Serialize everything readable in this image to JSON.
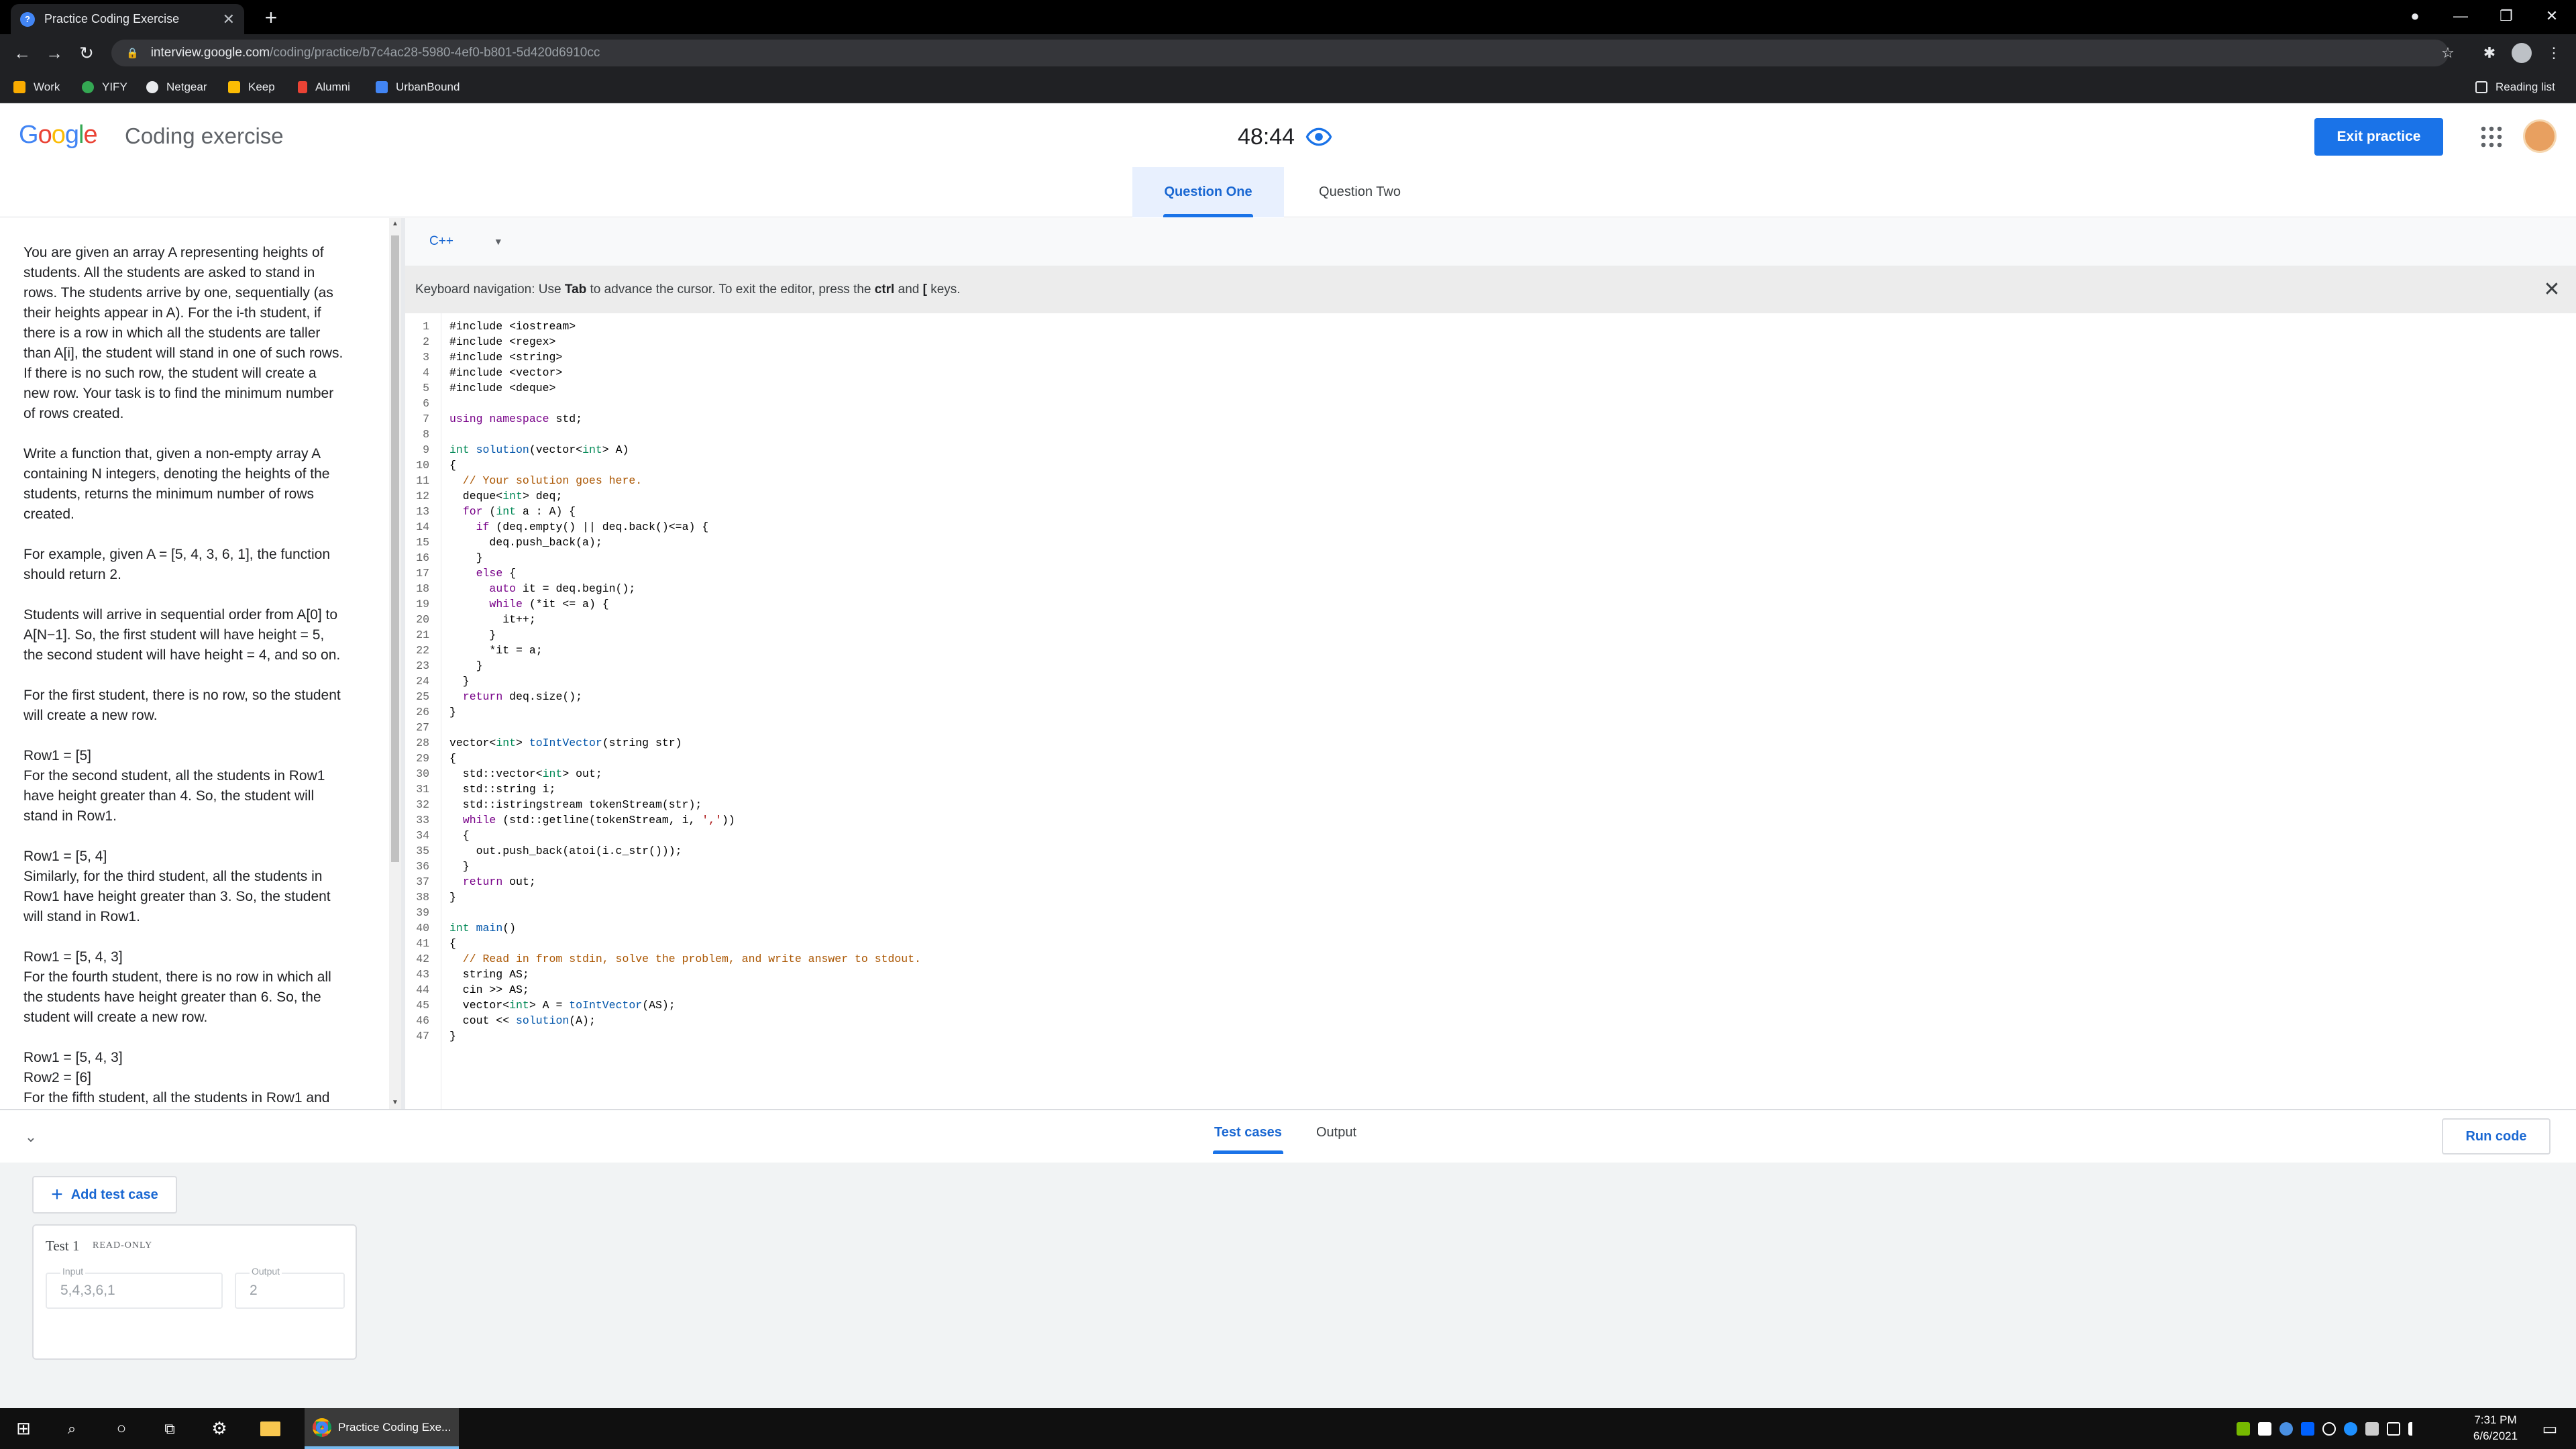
{
  "browser": {
    "tab_title": "Practice Coding Exercise",
    "url_host": "interview.google.com",
    "url_path": "/coding/practice/b7c4ac28-5980-4ef0-b801-5d420d6910cc",
    "bookmarks": [
      {
        "label": "Work",
        "icon": "folder-icon",
        "color": "#f9ab00"
      },
      {
        "label": "YIFY",
        "icon": "leaf-icon",
        "color": "#34a853"
      },
      {
        "label": "Netgear",
        "icon": "netgear-icon",
        "color": "#e8eaed"
      },
      {
        "label": "Keep",
        "icon": "keep-icon",
        "color": "#fbbc04"
      },
      {
        "label": "Alumni",
        "icon": "alumni-icon",
        "color": "#ea4335"
      },
      {
        "label": "UrbanBound",
        "icon": "urbanbound-icon",
        "color": "#4285f4"
      }
    ],
    "reading_list": "Reading list"
  },
  "header": {
    "logo": "Google",
    "title": "Coding exercise",
    "timer": "48:44",
    "exit_label": "Exit practice",
    "tabs": [
      {
        "label": "Question One",
        "active": true
      },
      {
        "label": "Question Two",
        "active": false
      }
    ]
  },
  "description": {
    "paragraphs": [
      [
        "You are given an array A representing heights of",
        "students. All the students are asked to stand in",
        "rows. The students arrive by one, sequentially (as",
        "their heights appear in A). For the i-th student, if",
        "there is a row in which all the students are taller",
        "than A[i], the student will stand in one of such rows.",
        "If there is no such row, the student will create a",
        "new row. Your task is to find the minimum number",
        "of rows created."
      ],
      [
        "Write a function that, given a non-empty array A",
        "containing N integers, denoting the heights of the",
        "students, returns the minimum number of rows",
        "created."
      ],
      [
        "For example, given A = [5, 4, 3, 6, 1], the function",
        "should return 2."
      ],
      [
        "Students will arrive in sequential order from A[0] to",
        "A[N−1]. So, the first student will have height = 5,",
        "the second student will have height = 4, and so on."
      ],
      [
        "For the first student, there is no row, so the student",
        "will create a new row."
      ],
      [
        "Row1 = [5]",
        "For the second student, all the students in Row1",
        "have height greater than 4. So, the student will",
        "stand in Row1."
      ],
      [
        "Row1 = [5, 4]",
        "Similarly, for the third student, all the students in",
        "Row1 have height greater than 3. So, the student",
        "will stand in Row1."
      ],
      [
        "Row1 = [5, 4, 3]",
        "For the fourth student, there is no row in which all",
        "the students have height greater than 6. So, the",
        "student will create a new row."
      ],
      [
        "Row1 = [5, 4, 3]",
        "Row2 = [6]",
        "For the fifth student, all the students in Row1 and"
      ]
    ]
  },
  "editor": {
    "language": "C++",
    "keyboard_hint_prefix": "Keyboard navigation: Use ",
    "keyboard_hint_tab": "Tab",
    "keyboard_hint_mid": " to advance the cursor. To exit the editor, press the ",
    "keyboard_hint_ctrl": "ctrl",
    "keyboard_hint_and": " and ",
    "keyboard_hint_bracket": "[",
    "keyboard_hint_suffix": " keys.",
    "code_lines": [
      "#include <iostream>",
      "#include <regex>",
      "#include <string>",
      "#include <vector>",
      "#include <deque>",
      "",
      "using namespace std;",
      "",
      "int solution(vector<int> A)",
      "{",
      "  // Your solution goes here.",
      "  deque<int> deq;",
      "  for (int a : A) {",
      "    if (deq.empty() || deq.back()<=a) {",
      "      deq.push_back(a);",
      "    }",
      "    else {",
      "      auto it = deq.begin();",
      "      while (*it <= a) {",
      "        it++;",
      "      }",
      "      *it = a;",
      "    }",
      "  }",
      "  return deq.size();",
      "}",
      "",
      "vector<int> toIntVector(string str)",
      "{",
      "  std::vector<int> out;",
      "  std::string i;",
      "  std::istringstream tokenStream(str);",
      "  while (std::getline(tokenStream, i, ','))",
      "  {",
      "    out.push_back(atoi(i.c_str()));",
      "  }",
      "  return out;",
      "}",
      "",
      "int main()",
      "{",
      "  // Read in from stdin, solve the problem, and write answer to stdout.",
      "  string AS;",
      "  cin >> AS;",
      "  vector<int> A = toIntVector(AS);",
      "  cout << solution(A);",
      "}"
    ]
  },
  "bottom": {
    "tab_testcases": "Test cases",
    "tab_output": "Output",
    "run_label": "Run code",
    "add_label": "Add test case",
    "tests": [
      {
        "name": "Test 1",
        "tag": "READ-ONLY",
        "input_label": "Input",
        "input": "5,4,3,6,1",
        "output_label": "Output",
        "output": "2"
      }
    ]
  },
  "taskbar": {
    "app_label": "Practice Coding Exe...",
    "time": "7:31 PM",
    "date": "6/6/2021"
  },
  "colors": {
    "accent": "#1a73e8",
    "active_tab_bg": "#e8f0fe"
  }
}
